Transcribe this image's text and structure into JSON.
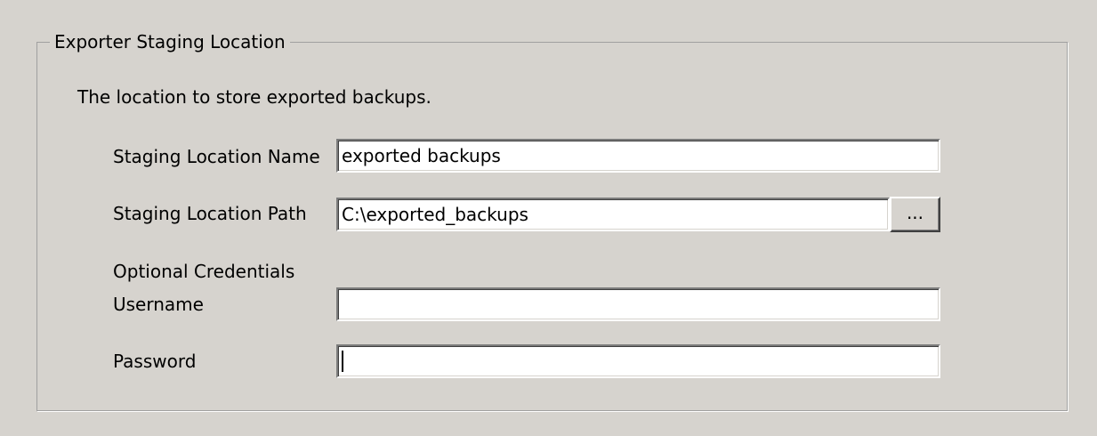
{
  "group": {
    "title": "Exporter Staging Location",
    "description": "The location to store exported backups."
  },
  "fields": {
    "name": {
      "label": "Staging Location Name",
      "value": "exported backups"
    },
    "path": {
      "label": "Staging Location Path",
      "value": "C:\\exported_backups",
      "browse_label": "..."
    },
    "credentials_heading": "Optional Credentials",
    "username": {
      "label": "Username",
      "value": ""
    },
    "password": {
      "label": "Password",
      "value": ""
    }
  },
  "colors": {
    "background": "#d6d3ce",
    "input_background": "#ffffff",
    "text": "#000000"
  }
}
